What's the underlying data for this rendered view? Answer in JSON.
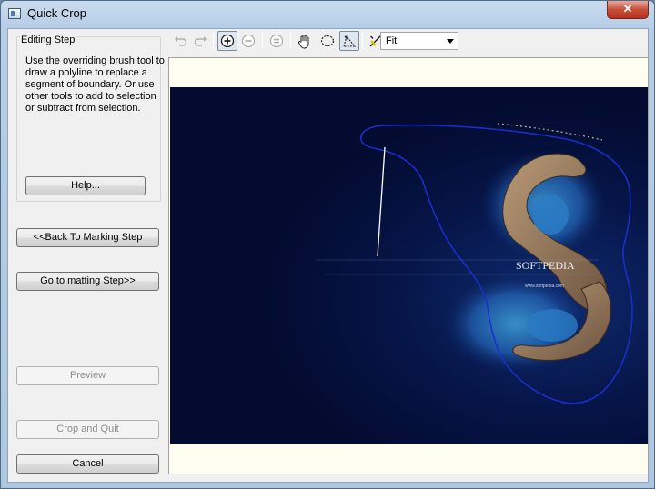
{
  "window": {
    "title": "Quick Crop",
    "close_glyph": "✕"
  },
  "editing_step": {
    "title": "Editing Step",
    "description": "Use the overriding brush tool to draw a polyline to replace a segment of boundary. Or use other tools to add to selection or subtract from selection."
  },
  "buttons": {
    "help": "Help...",
    "back": "<<Back To Marking Step",
    "matting": "Go to matting Step>>",
    "preview": "Preview",
    "crop_quit": "Crop and Quit",
    "cancel": "Cancel"
  },
  "toolbar": {
    "zoom_value": "Fit",
    "icons": [
      "undo-icon",
      "redo-icon",
      "zoom-in-icon",
      "zoom-out-icon",
      "zoom-reset-icon",
      "hand-pan-icon",
      "lasso-select-icon",
      "polygon-select-icon",
      "override-brush-icon"
    ]
  },
  "image": {
    "watermark_title": "SOFTPEDIA",
    "watermark_url": "www.softpedia.com"
  },
  "colors": {
    "selection_outline": "#1a2fd0",
    "brush_line": "#ffffff",
    "image_background": "#061548"
  }
}
